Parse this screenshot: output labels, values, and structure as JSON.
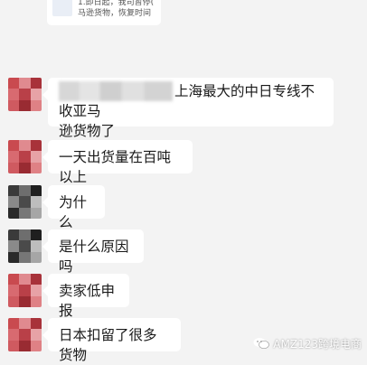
{
  "top_card": {
    "line1": "1.即日起，我司暂停(",
    "line2": "马逊货物，恢复时间"
  },
  "messages": [
    {
      "text": "上海最大的中日专线不收亚马逊货物了",
      "line1": "上海最大的中日专线不收亚马",
      "line2": "逊货物了"
    },
    {
      "text": "一天出货量在百吨以上"
    },
    {
      "text": "为什么"
    },
    {
      "text": "是什么原因吗"
    },
    {
      "text": "卖家低申报"
    },
    {
      "text": "日本扣留了很多货物"
    }
  ],
  "watermark": {
    "text": "AMZ123跨境电商"
  },
  "colors": {
    "background": "#f3f3f3",
    "bubble": "#ffffff",
    "avatar_red": [
      "#c94a4f",
      "#e08a8f",
      "#a8323a",
      "#d86a70",
      "#b94048",
      "#e7a2a6",
      "#cf5a60",
      "#992b32",
      "#df8185"
    ],
    "avatar_dark": [
      "#3a3a3a",
      "#6e6e6e",
      "#1f1f1f",
      "#8a8a8a",
      "#4a4a4a",
      "#bdbdbd",
      "#2a2a2a",
      "#777",
      "#a6a6a6"
    ]
  }
}
